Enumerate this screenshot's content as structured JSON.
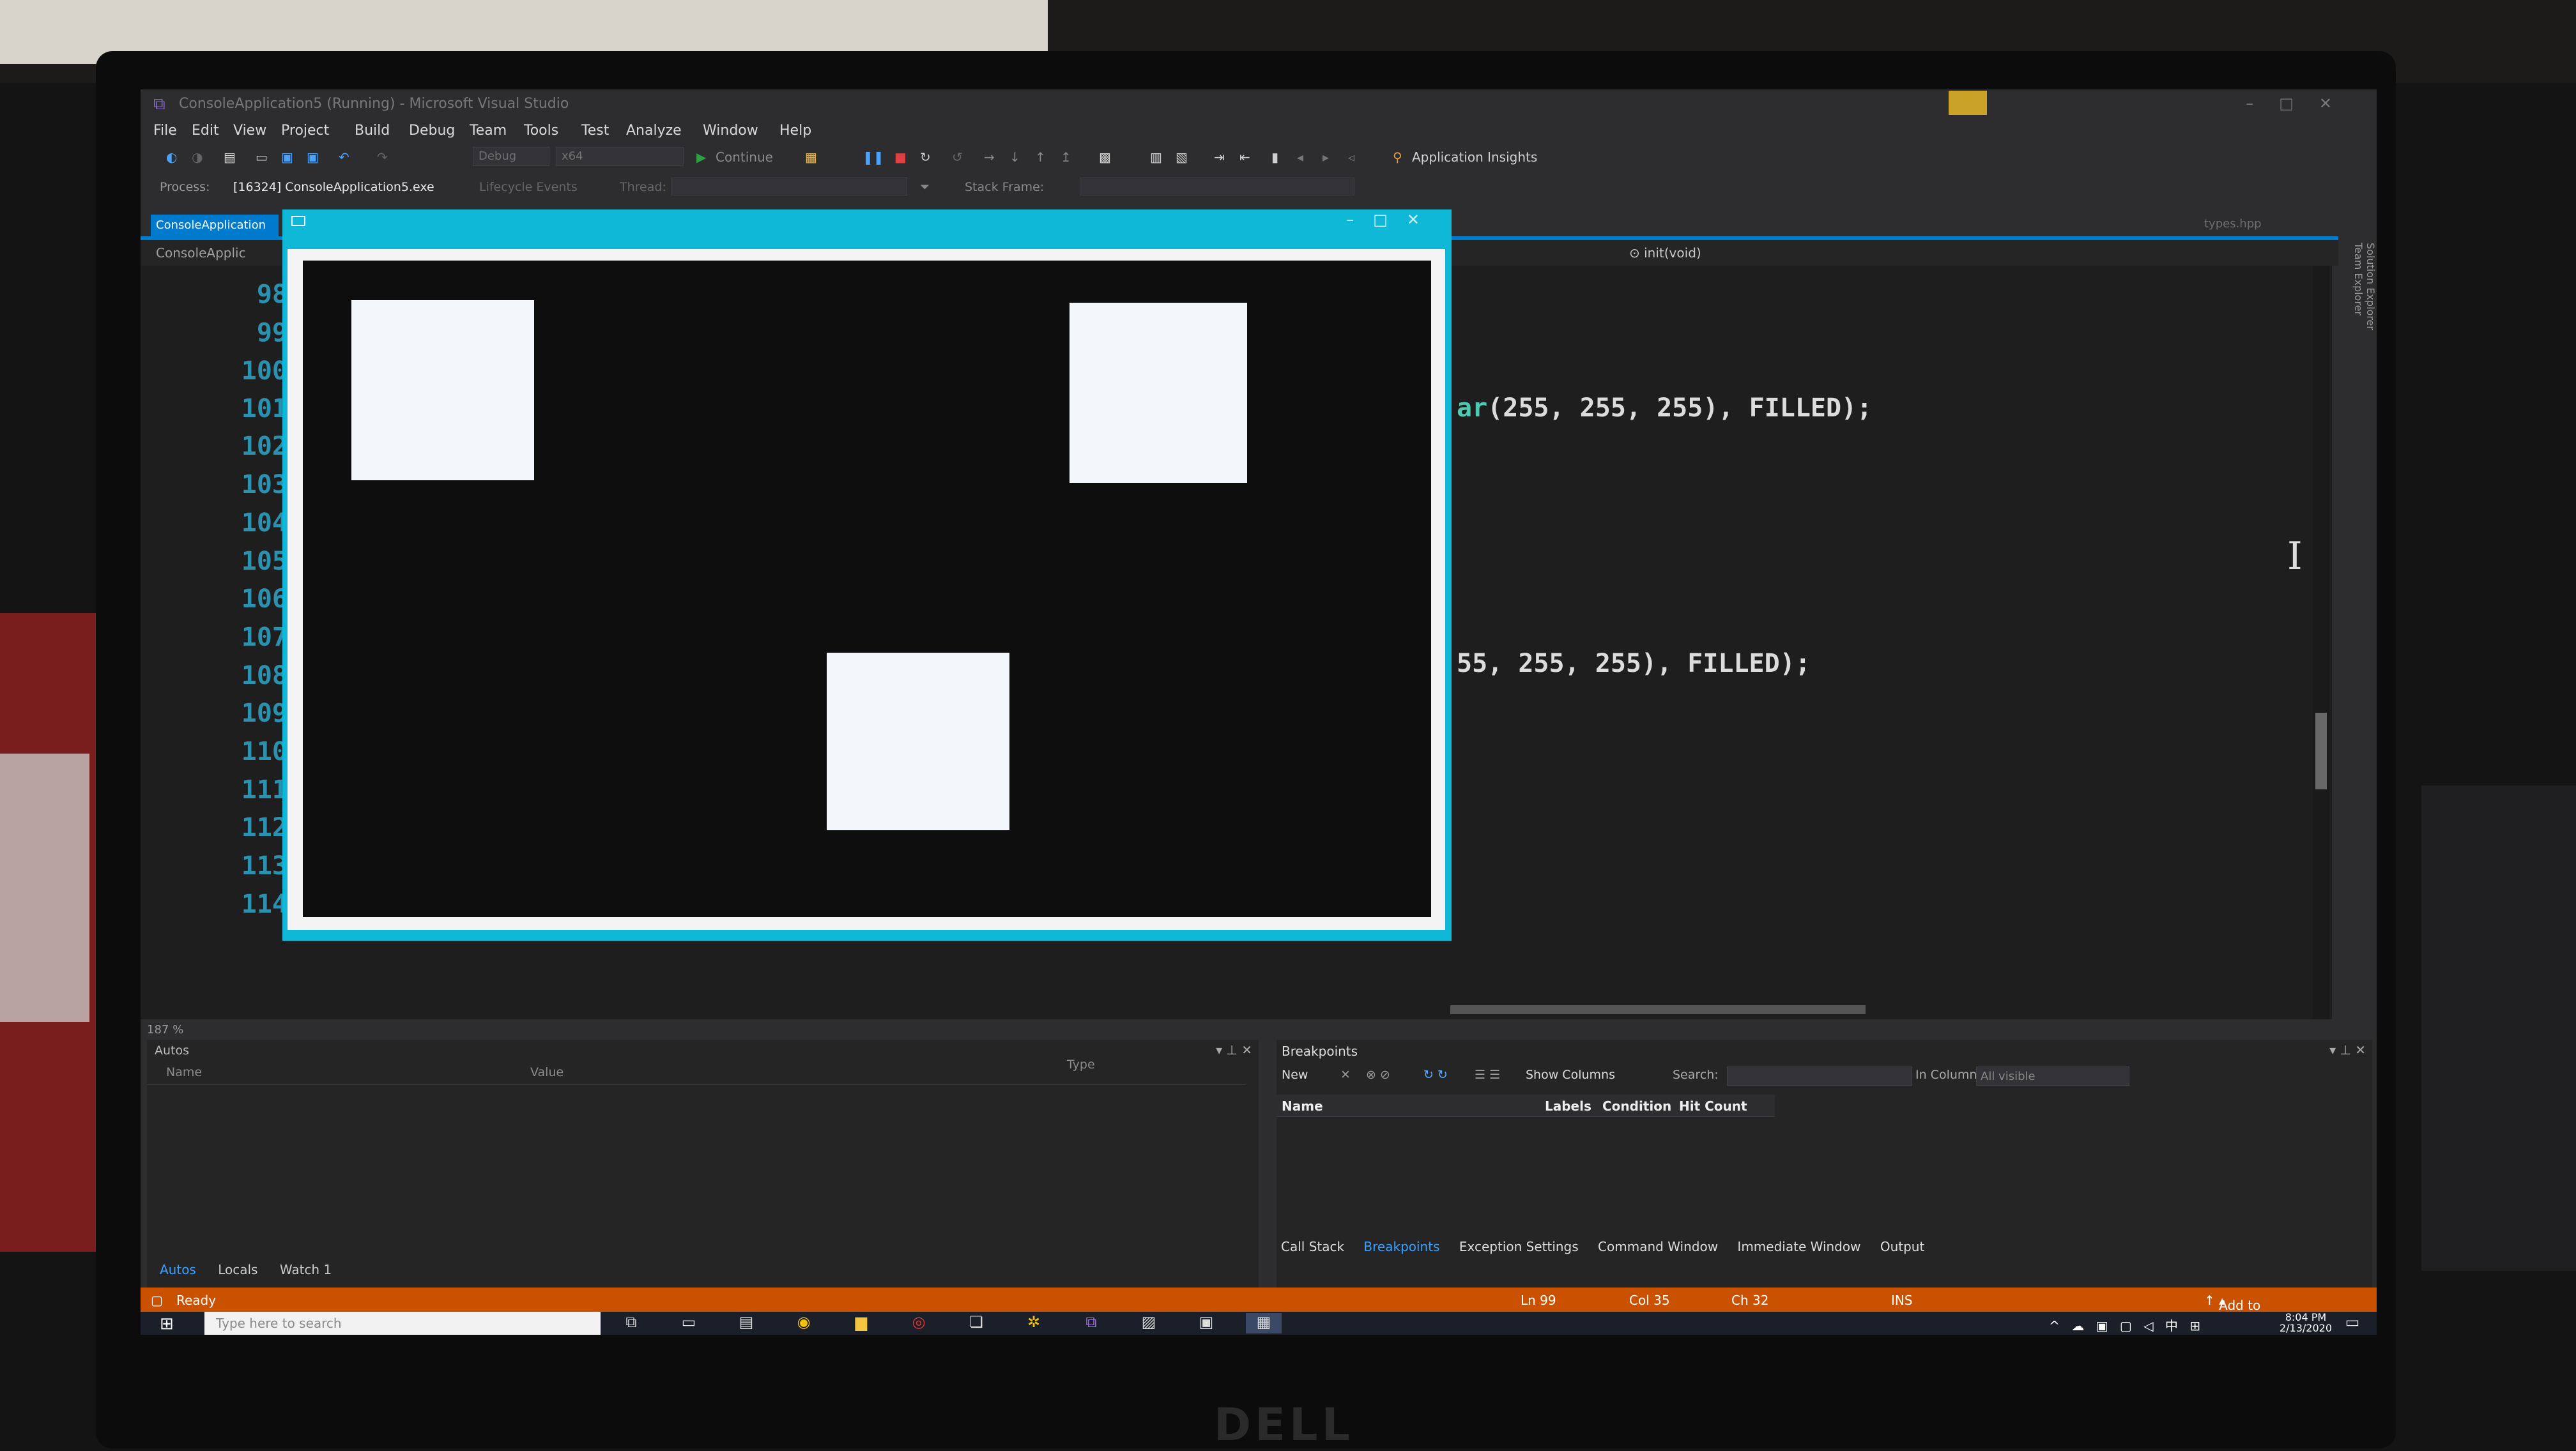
{
  "window": {
    "title": "ConsoleApplication5 (Running) - Microsoft Visual Studio"
  },
  "menu": [
    "File",
    "Edit",
    "View",
    "Project",
    "Build",
    "Debug",
    "Team",
    "Tools",
    "Test",
    "Analyze",
    "Window",
    "Help"
  ],
  "toolbar": {
    "config": "Debug",
    "platform": "x64",
    "continue_label": "Continue",
    "app_insights_label": "Application Insights"
  },
  "process_bar": {
    "process_label": "Process:",
    "process_value": "[16324] ConsoleApplication5.exe",
    "lifecycle_label": "Lifecycle Events",
    "thread_label": "Thread:",
    "stack_frame_label": "Stack Frame:"
  },
  "doc_tab": {
    "label": "ConsoleApplication",
    "right_file": "types.hpp"
  },
  "navbar": {
    "left": "ConsoleApplic",
    "right": "init(void)"
  },
  "editor": {
    "line_numbers": [
      "98",
      "99",
      "100",
      "101",
      "102",
      "103",
      "104",
      "105",
      "106",
      "107",
      "108",
      "109",
      "110",
      "111",
      "112",
      "113",
      "114"
    ],
    "code_line_a_fn": "ar",
    "code_line_a_rest": "(255, 255, 255), FILLED);",
    "code_line_b": "55, 255, 255), FILLED);"
  },
  "zoom": "187 %",
  "autos": {
    "title": "Autos",
    "columns": [
      "Name",
      "Value",
      "Type"
    ]
  },
  "breakpoints": {
    "title": "Breakpoints",
    "new_label": "New",
    "show_columns_label": "Show Columns",
    "search_label": "Search:",
    "in_column_label": "In Column:",
    "in_column_value": "All visible",
    "columns": [
      "Name",
      "Labels",
      "Condition",
      "Hit Count"
    ]
  },
  "bottom_tabs_left": [
    "Autos",
    "Locals",
    "Watch 1"
  ],
  "bottom_tabs_right": [
    "Call Stack",
    "Breakpoints",
    "Exception Settings",
    "Command Window",
    "Immediate Window",
    "Output"
  ],
  "status": {
    "ready": "Ready",
    "ln": "Ln 99",
    "col": "Col 35",
    "ch": "Ch 32",
    "ins": "INS",
    "source_control": "Add to Source Control"
  },
  "taskbar": {
    "search_placeholder": "Type here to search",
    "time": "8:04 PM",
    "date": "2/13/2020"
  },
  "brand": "DELL",
  "colors": {
    "status_bar": "#ca5100",
    "accent": "#007acc",
    "opencv_titlebar": "#10b8d8",
    "line_number": "#2b91af"
  }
}
